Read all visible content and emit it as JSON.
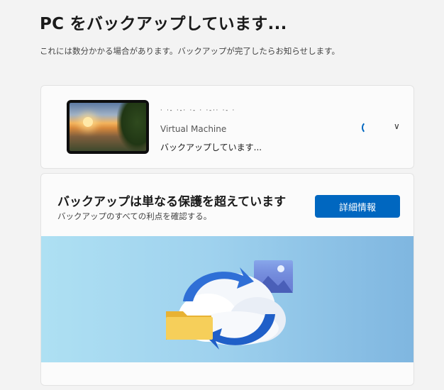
{
  "header": {
    "title": "PC をバックアップしています...",
    "subtitle": "これには数分かかる場合があります。バックアップが完了したらお知らせします。"
  },
  "device": {
    "name": "· ·- ·-· ·- · ·-·· ·- ·",
    "type": "Virtual Machine",
    "status": "バックアップしています...",
    "thumbnail_icon": "beach-sunset-wallpaper",
    "spinner_icon": "progress-ring-icon",
    "expand_icon": "chevron-down-icon"
  },
  "promo": {
    "title": "バックアップは単なる保護を超えています",
    "subtitle": "バックアップのすべての利点を確認する。",
    "button_label": "詳細情報",
    "illustration_icon": "cloud-sync-icon"
  },
  "colors": {
    "accent": "#0067c0",
    "background": "#f3f3f3",
    "card": "#fbfbfb"
  }
}
